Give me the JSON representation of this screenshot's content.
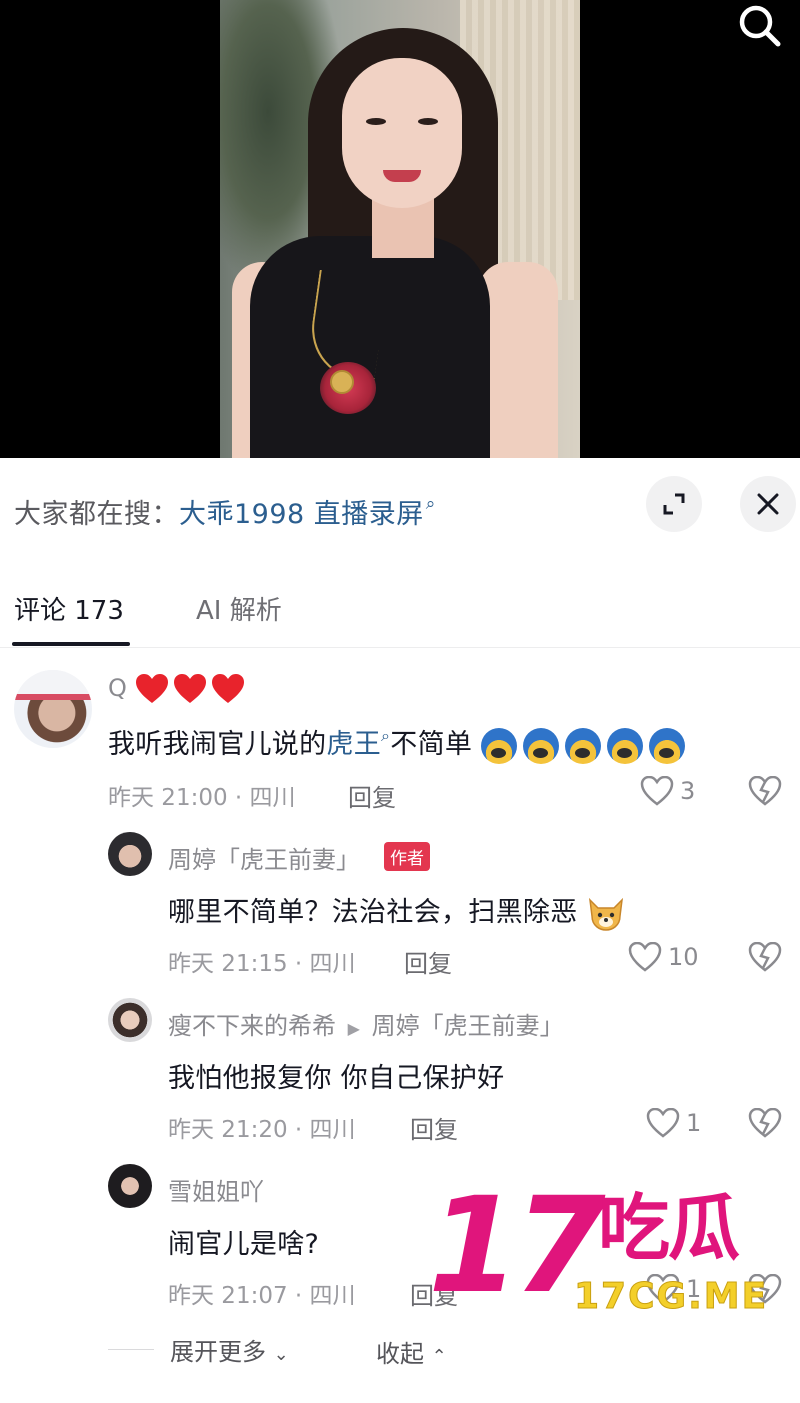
{
  "suggest": {
    "prefix": "大家都在搜：",
    "query": "大乖1998 直播录屏",
    "query_icon": "search-icon"
  },
  "tabs": {
    "comments_label": "评论 173",
    "ai_label": "AI 解析"
  },
  "comments": [
    {
      "username": "Q",
      "username_suffix_icons": [
        "red-heart-emoji",
        "red-heart-emoji",
        "red-heart-emoji"
      ],
      "text_before": "我听我闹官儿说的",
      "highlight": "虎王",
      "text_after": "不简单",
      "trailing_emoji": "fearful-face-emoji",
      "time": "昨天 21:00 · 四川",
      "reply_label": "回复",
      "likes": "3"
    },
    {
      "username": "周婷「虎王前妻」",
      "badge": "作者",
      "text": "哪里不简单？法治社会，扫黑除恶",
      "trailing_emoji": "dog-face-emoji",
      "time": "昨天 21:15 · 四川",
      "reply_label": "回复",
      "likes": "10"
    },
    {
      "username": "瘦不下来的希希",
      "reply_to": "周婷「虎王前妻」",
      "text": "我怕他报复你 你自己保护好",
      "time": "昨天 21:20 · 四川",
      "reply_label": "回复",
      "likes": "1"
    },
    {
      "username": "雪姐姐吖",
      "text": "闹官儿是啥?",
      "time": "昨天 21:07 · 四川",
      "reply_label": "回复",
      "likes": "1"
    }
  ],
  "footer": {
    "expand_more": "展开更多",
    "collapse": "收起"
  },
  "watermark": {
    "number": "17",
    "chinese": "吃瓜",
    "url": "17CG.ME"
  },
  "colors": {
    "link": "#2b5e8f",
    "badge": "#e3364f",
    "watermark_pink": "#e0157c",
    "watermark_yellow": "#f3cf2a"
  }
}
